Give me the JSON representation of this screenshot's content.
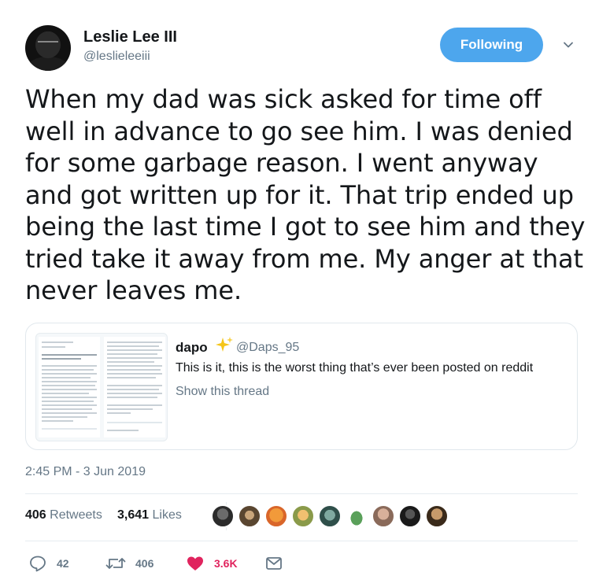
{
  "author": {
    "name": "Leslie Lee III",
    "handle": "@leslieleeiii",
    "follow_label": "Following"
  },
  "tweet": {
    "text": "When my dad was sick asked for time off well in advance to go see him. I was denied for some garbage reason. I went anyway and got written up for it. That trip ended up being the last time I got to see him and they tried take it away from me. My anger at that never leaves me.",
    "timestamp": "2:45 PM - 3 Jun 2019"
  },
  "quoted": {
    "name": "dapo",
    "emoji_icon": "sparkles-icon",
    "handle": "@Daps_95",
    "text": "This is it, this is the worst thing that’s ever been posted on reddit",
    "show_thread": "Show this thread"
  },
  "stats": {
    "retweets_count": "406",
    "retweets_label": "Retweets",
    "likes_count": "3,641",
    "likes_label": "Likes"
  },
  "actions": {
    "replies": "42",
    "retweets": "406",
    "likes": "3.6K"
  },
  "colors": {
    "accent": "#4da6ed",
    "like_red": "#e0245e",
    "muted": "#657786"
  }
}
